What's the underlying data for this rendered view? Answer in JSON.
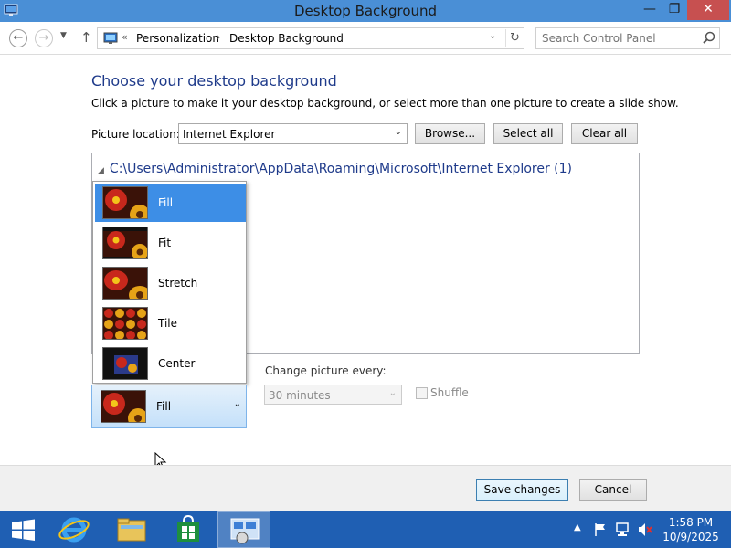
{
  "window": {
    "title": "Desktop Background",
    "min_glyph": "—",
    "max_glyph": "❐",
    "close_glyph": "✕"
  },
  "address": {
    "prefix": "«",
    "segments": [
      "Personalization",
      "Desktop Background"
    ],
    "separator": "›",
    "search_placeholder": "Search Control Panel"
  },
  "content": {
    "heading": "Choose your desktop background",
    "instruction": "Click a picture to make it your desktop background, or select more than one picture to create a slide show.",
    "picture_location_label": "Picture location:",
    "picture_location_value": "Internet Explorer",
    "browse_label": "Browse...",
    "select_all_label": "Select all",
    "clear_all_label": "Clear all",
    "folder_path": "C:\\Users\\Administrator\\AppData\\Roaming\\Microsoft\\Internet Explorer (1)"
  },
  "position": {
    "options": [
      "Fill",
      "Fit",
      "Stretch",
      "Tile",
      "Center"
    ],
    "selected": "Fill"
  },
  "slideshow": {
    "change_label": "Change picture every:",
    "interval_value": "30 minutes",
    "shuffle_label": "Shuffle"
  },
  "footer": {
    "save_label": "Save changes",
    "cancel_label": "Cancel"
  },
  "taskbar": {
    "time": "1:58 PM",
    "date": "10/9/2025"
  },
  "colors": {
    "titlebar": "#4a8fd6",
    "heading": "#1e3a8a",
    "selection": "#3d8ee6",
    "taskbar": "#1f5fb3",
    "close_button": "#c75050"
  }
}
